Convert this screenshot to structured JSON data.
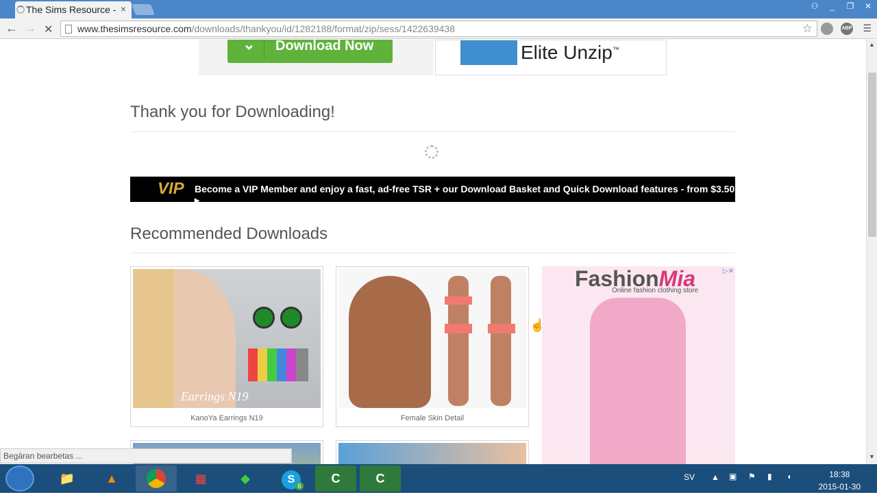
{
  "browser": {
    "tab_title": "The Sims Resource -",
    "tab_close": "×",
    "url_domain": "www.thesimsresource.com",
    "url_path": "/downloads/thankyou/id/1282188/format/zip/sess/1422639438",
    "back_icon": "←",
    "forward_icon": "→",
    "stop_icon": "✕",
    "star_icon": "☆",
    "abp_label": "ABP",
    "menu_icon": "☰",
    "win_min": "_",
    "win_restore": "❐",
    "win_close": "✕",
    "win_user": "⚇"
  },
  "page": {
    "download_now_label": "Download Now",
    "download_chevron": "⌄",
    "elite_unzip_label": "Elite Unzip",
    "elite_unzip_tm": "™",
    "thank_you_heading": "Thank you for Downloading!",
    "vip_logo": "VIP",
    "vip_text": "Become a VIP Member and enjoy a fast, ad-free TSR + our Download Basket and Quick Download features - from $3.50",
    "vip_arrow": "▸",
    "recommended_heading": "Recommended Downloads",
    "cards": [
      {
        "caption": "KanoYa Earrings N19",
        "overlay": "Earrings N19"
      },
      {
        "caption": "Female Skin Detail"
      }
    ],
    "ad": {
      "brand_prefix": "Fashion",
      "brand_suffix": "Mia",
      "tagline": "Online fashion clothing store",
      "adchoices": "▷✕"
    }
  },
  "status_bar": {
    "text": "Begäran bearbetas ..."
  },
  "taskbar": {
    "language": "SV",
    "time": "18:38",
    "date": "2015-01-30",
    "skype_badge": "6"
  },
  "colors": {
    "accent_green": "#5fb33a",
    "vip_gold": "#d4a93d",
    "chrome_blue": "#4a86c8",
    "taskbar_blue": "#1c4e7c"
  }
}
